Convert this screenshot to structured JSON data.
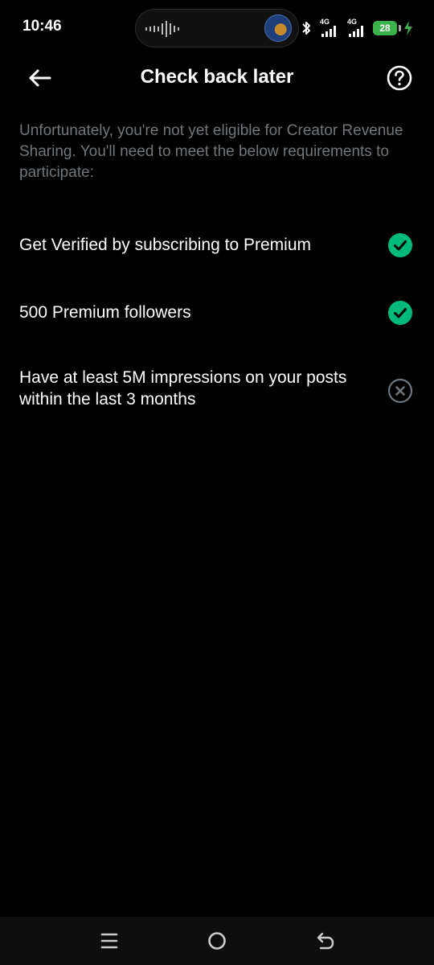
{
  "status_bar": {
    "time": "10:46",
    "network_1": "4G",
    "network_2": "4G",
    "battery": "28",
    "icons": [
      "audio-wave-icon",
      "avatar",
      "bluetooth-icon",
      "signal-icon",
      "signal-icon",
      "battery-icon",
      "charging-icon"
    ]
  },
  "header": {
    "title": "Check back later",
    "back_icon": "arrow-left-icon",
    "help_icon": "help-circle-icon"
  },
  "intro_text": "Unfortunately, you're not yet eligible for Creator Revenue Sharing. You'll need to meet the below requirements to participate:",
  "requirements": [
    {
      "label": "Get Verified by subscribing to Premium",
      "met": true,
      "icon": "check-circle-icon"
    },
    {
      "label": "500 Premium followers",
      "met": true,
      "icon": "check-circle-icon"
    },
    {
      "label": "Have at least 5M impressions on your posts within the last 3 months",
      "met": false,
      "icon": "x-circle-icon"
    }
  ],
  "nav_bar": {
    "icons": [
      "menu-icon",
      "home-icon",
      "back-icon"
    ]
  },
  "colors": {
    "background": "#000000",
    "met": "#00ba7c",
    "unmet": "#6e767d",
    "secondary_text": "#71767b"
  }
}
